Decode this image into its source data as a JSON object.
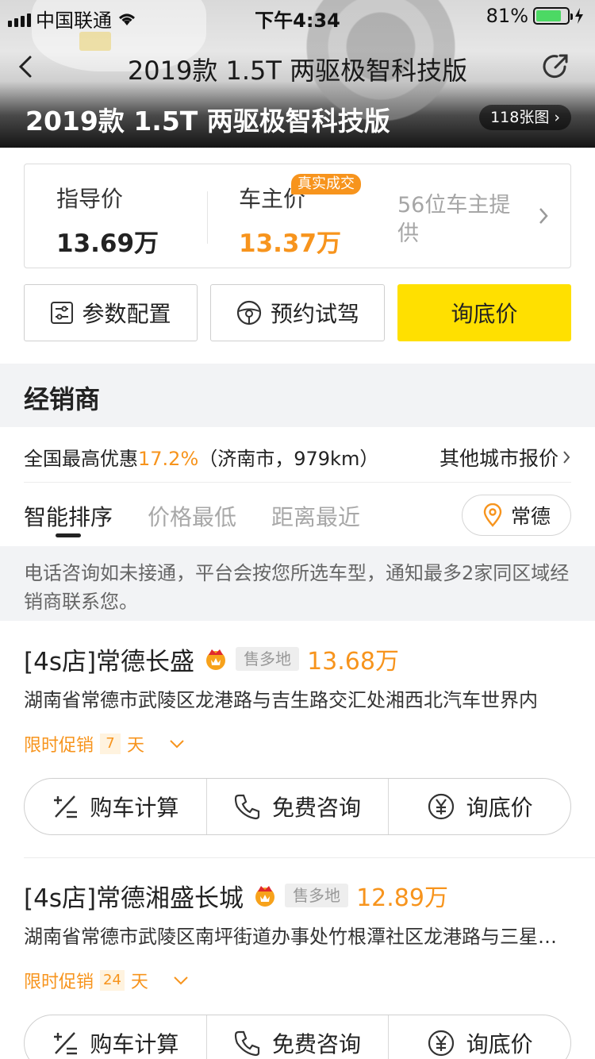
{
  "status_bar": {
    "carrier": "中国联通",
    "time": "下午4:34",
    "battery_percent": "81%",
    "battery_level": 0.81
  },
  "header": {
    "nav_title": "2019款 1.5T 两驱极智科技版",
    "hero_title": "2019款 1.5T 两驱极智科技版",
    "photo_count": "118张图"
  },
  "price_card": {
    "guide_label": "指导价",
    "guide_value": "13.69万",
    "owner_label": "车主价",
    "owner_value": "13.37万",
    "owner_badge": "真实成交",
    "owner_count": "56位车主提供"
  },
  "actions": {
    "params": "参数配置",
    "test_drive": "预约试驾",
    "inquiry": "询底价"
  },
  "dealers_section": {
    "title": "经销商",
    "discount_prefix": "全国最高优惠",
    "discount_value": "17.2%",
    "discount_suffix": "（济南市，979km）",
    "other_city": "其他城市报价",
    "sort_tabs": [
      "智能排序",
      "价格最低",
      "距离最近"
    ],
    "city": "常德",
    "notice": "电话咨询如未接通，平台会按您所选车型，通知最多2家同区域经销商联系您。"
  },
  "dealers": [
    {
      "name": "[4s店]常德长盛",
      "tag": "售多地",
      "price": "13.68万",
      "address": "湖南省常德市武陵区龙港路与吉生路交汇处湘西北汽车世界内",
      "promo_label": "限时促销",
      "promo_days": "7",
      "promo_unit": "天"
    },
    {
      "name": "[4s店]常德湘盛长城",
      "tag": "售多地",
      "price": "12.89万",
      "address": "湖南省常德市武陵区南坪街道办事处竹根潭社区龙港路与三星…",
      "promo_label": "限时促销",
      "promo_days": "24",
      "promo_unit": "天"
    }
  ],
  "dealer_actions": {
    "calc": "购车计算",
    "consult": "免费咨询",
    "inquiry": "询底价"
  },
  "colors": {
    "accent_orange": "#f7941d",
    "button_yellow": "#ffe000",
    "section_bg": "#f2f3f5"
  }
}
